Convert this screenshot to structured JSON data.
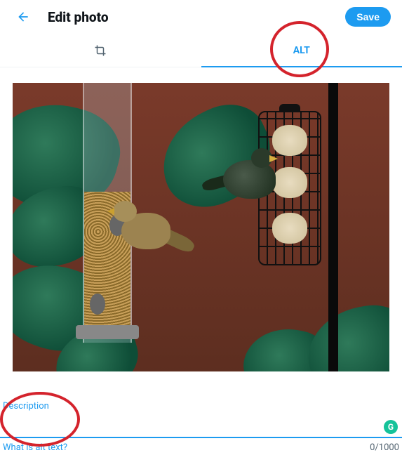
{
  "header": {
    "title": "Edit photo",
    "save_label": "Save"
  },
  "tabs": {
    "alt_label": "ALT"
  },
  "description": {
    "label": "Description",
    "value": "",
    "placeholder": ""
  },
  "footer": {
    "alt_help_link": "What is alt text?",
    "char_count": "0/1000"
  },
  "icons": {
    "back": "arrow-left",
    "crop": "crop",
    "grammarly": "G"
  },
  "colors": {
    "accent": "#1d9bf0",
    "annotation": "#d4232c"
  }
}
